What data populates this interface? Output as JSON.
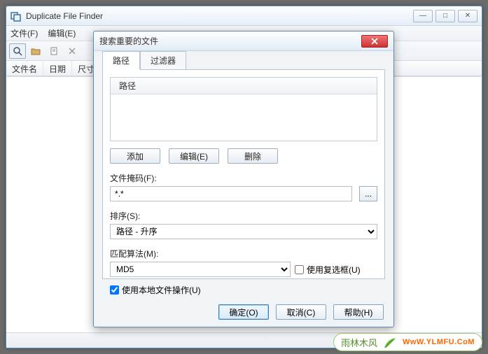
{
  "main": {
    "title": "Duplicate File Finder",
    "menus": {
      "file": "文件(F)",
      "edit": "编辑(E)"
    },
    "columns": {
      "name": "文件名",
      "date": "日期",
      "size": "尺寸"
    },
    "winbtn": {
      "min": "—",
      "max": "□",
      "close": "✕"
    }
  },
  "dialog": {
    "title": "搜索重要的文件",
    "tabs": {
      "path": "路径",
      "filter": "过滤器"
    },
    "path_header": "路径",
    "buttons": {
      "add": "添加",
      "edit": "编辑(E)",
      "delete": "删除"
    },
    "mask_label": "文件掩码(F):",
    "mask_value": "*.*",
    "mask_browse": "...",
    "sort_label": "排序(S):",
    "sort_value": "路径 - 升序",
    "algo_label": "匹配算法(M):",
    "algo_value": "MD5",
    "use_checkbox_label": "使用复选框(U)",
    "use_checkbox_checked": false,
    "use_local_label": "使用本地文件操作(U)",
    "use_local_checked": true,
    "ok": "确定(O)",
    "cancel": "取消(C)",
    "help": "帮助(H)"
  },
  "watermark": {
    "cn": "雨林木风",
    "url": "WwW.YLMFU.CoM"
  }
}
